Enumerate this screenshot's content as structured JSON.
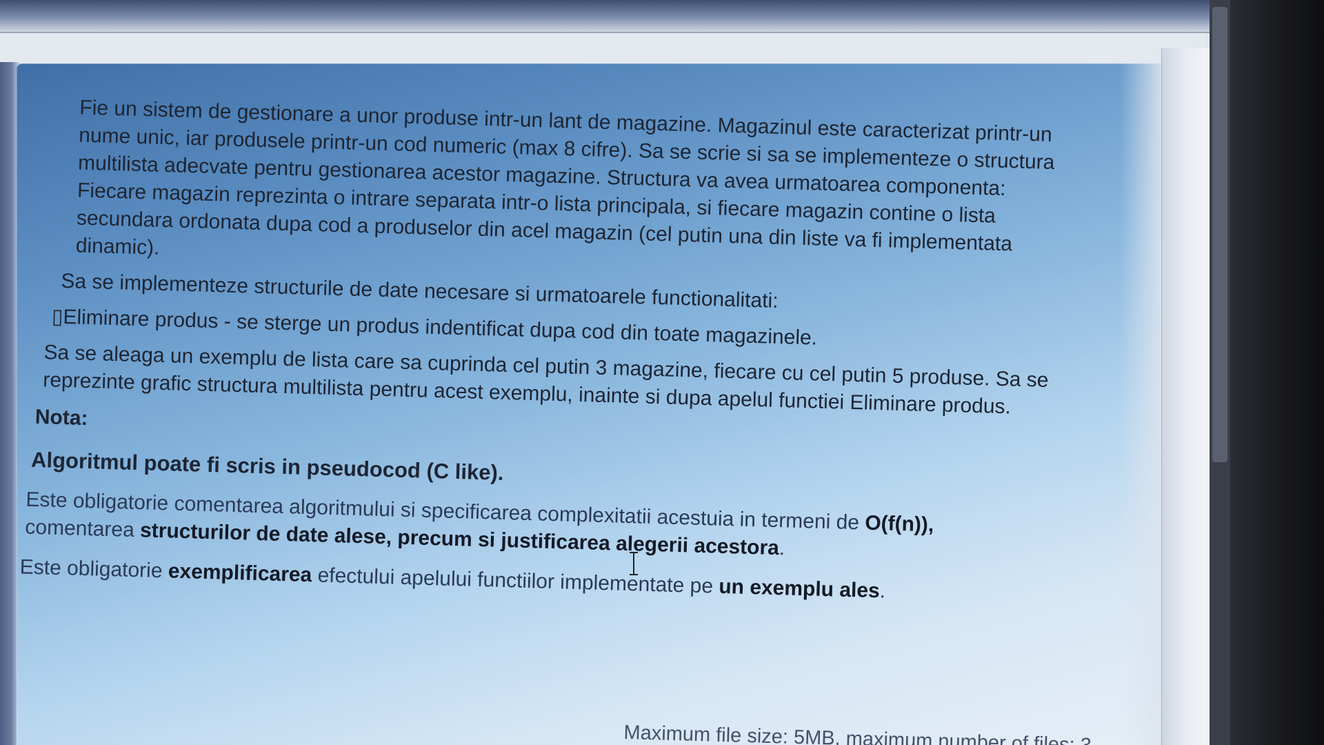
{
  "assignment": {
    "intro": "Fie un sistem de gestionare a unor produse intr-un lant de magazine. Magazinul este caracterizat printr-un nume unic, iar produsele printr-un cod numeric (max 8 cifre). Sa se scrie si sa se implementeze o structura multilista adecvate pentru gestionarea acestor magazine. Structura va avea urmatoarea componenta: Fiecare magazin reprezinta o intrare separata intr-o lista principala, si fiecare magazin contine o lista secundara ordonata dupa cod a produselor din acel magazin (cel putin una din liste va fi implementata dinamic).",
    "requirement": "Sa se implementeze structurile de date necesare si urmatoarele functionalitati:",
    "function_item": "▯Eliminare produs - se sterge un produs indentificat dupa cod din toate magazinele.",
    "example": "Sa se aleaga un exemplu de lista care sa cuprinda cel putin 3 magazine, fiecare cu cel putin 5 produse. Sa se reprezinte grafic structura multilista pentru acest exemplu, inainte si dupa apelul functiei Eliminare produs."
  },
  "nota": {
    "label": "Nota:",
    "algorithm": "Algoritmul poate fi scris in pseudocod (C like).",
    "obligation1": {
      "part1": "Este obligatorie comentarea algoritmului si specificarea complexitatii acestuia in termeni de ",
      "bold1": "O(f(n)),",
      "part2": " comentarea ",
      "bold2": "structurilor de date alese, precum si justificarea alegerii acestora",
      "part3": "."
    },
    "obligation2": {
      "part1": "Este obligatorie ",
      "bold1": "exemplificarea",
      "part2": " efectului apelului functiilor implementate pe ",
      "bold2": "un exemplu ales",
      "part3": "."
    }
  },
  "upload": {
    "file_limits": "Maximum file size: 5MB, maximum number of files: 3"
  }
}
